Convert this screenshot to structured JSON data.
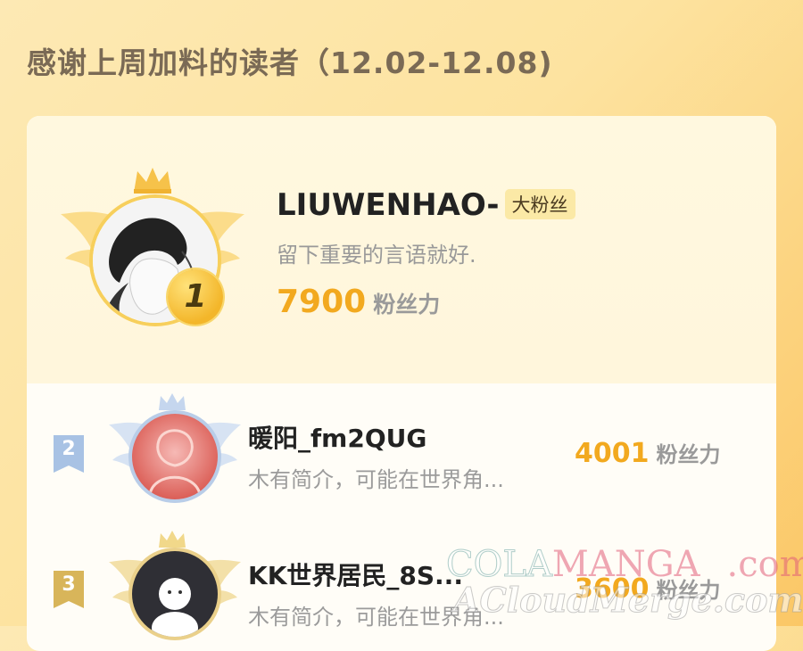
{
  "title": "感谢上周加料的读者（12.02-12.08)",
  "score_unit": "粉丝力",
  "top_reader": {
    "rank": "1",
    "name": "LIUWENHAO-",
    "badge": "大粉丝",
    "bio": "留下重要的言语就好.",
    "score": "7900"
  },
  "readers": [
    {
      "rank": "2",
      "name": "暖阳_fm2QUG",
      "bio": "木有简介，可能在世界角...",
      "score": "4001"
    },
    {
      "rank": "3",
      "name": "KK世界居民_8S...",
      "bio": "木有简介，可能在世界角...",
      "score": "3600"
    }
  ],
  "watermark": {
    "line1_a": "COLA",
    "line1_b": "MANGA",
    "line1_c": ".com",
    "line2": "ACloudMerge.com"
  },
  "colors": {
    "gold": "#f2a91f",
    "silver": "#9ab4d6",
    "bronze": "#d8b55a"
  }
}
